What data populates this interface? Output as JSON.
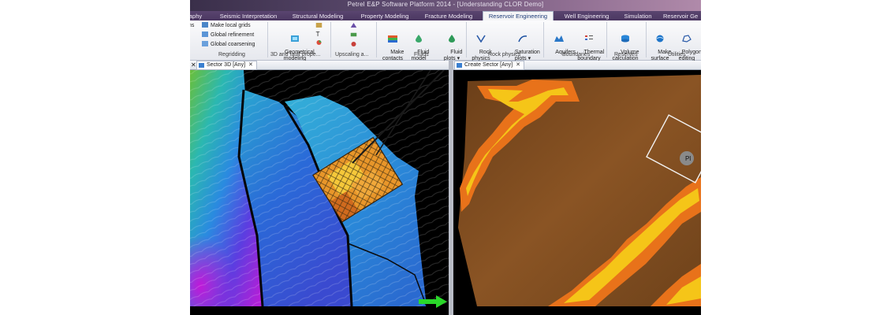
{
  "window": {
    "title": "Petrel E&P Software Platform 2014 - [Understanding CLOR Demo]"
  },
  "tabs": [
    {
      "label": "aphy",
      "active": false
    },
    {
      "label": "Seismic Interpretation",
      "active": false
    },
    {
      "label": "Structural Modeling",
      "active": false
    },
    {
      "label": "Property Modeling",
      "active": false
    },
    {
      "label": "Fracture Modeling",
      "active": false
    },
    {
      "label": "Reservoir Engineering",
      "active": true
    },
    {
      "label": "Well Engineering",
      "active": false
    },
    {
      "label": "Simulation",
      "active": false
    },
    {
      "label": "Reservoir Ge",
      "active": false
    }
  ],
  "ribbon": {
    "regridding": {
      "items": [
        "Make local grids",
        "Global refinement",
        "Global coarsening"
      ],
      "label": "Regridding"
    },
    "fault_props": {
      "button": "Geometrical\nmodeling",
      "label": "3D and fault prope..."
    },
    "upscaling": {
      "label": "Upscaling a..."
    },
    "fluids": {
      "buttons": [
        "Make\ncontacts",
        "Fluid\nmodel",
        "Fluid\nplots ▾"
      ],
      "label": "Fluids"
    },
    "rock_physics": {
      "buttons": [
        "Rock\nphysics",
        "Saturation\nplots ▾"
      ],
      "label": "Rock physics"
    },
    "boundaries": {
      "buttons": [
        "Aquifers",
        "Thermal\nboundary"
      ],
      "label": "Boundaries"
    },
    "reserves": {
      "buttons": [
        "Volume\ncalculation"
      ],
      "label": "Reserves"
    },
    "utilities": {
      "buttons": [
        "Make\nsurface",
        "Polygon\nediting"
      ],
      "label": "Utilities"
    }
  },
  "views": {
    "left": {
      "tab": "Sector 3D [Any]"
    },
    "right": {
      "tab": "Create Sector [Any]"
    }
  },
  "icons": [
    "grid-icon",
    "geometry-icon",
    "upscale-icon",
    "contacts-icon",
    "fluid-icon",
    "rock-icon",
    "saturation-icon",
    "aquifer-icon",
    "thermal-icon",
    "volume-icon",
    "surface-icon",
    "polygon-icon",
    "view-icon",
    "close-icon",
    "arrow-icon"
  ],
  "colors": {
    "accent": "#1f3c78",
    "active_tab": "#f4f4f6",
    "sector_orange": "#e8721a",
    "sector_yellow": "#f5c518",
    "background_brown": "#7a4a1e"
  }
}
